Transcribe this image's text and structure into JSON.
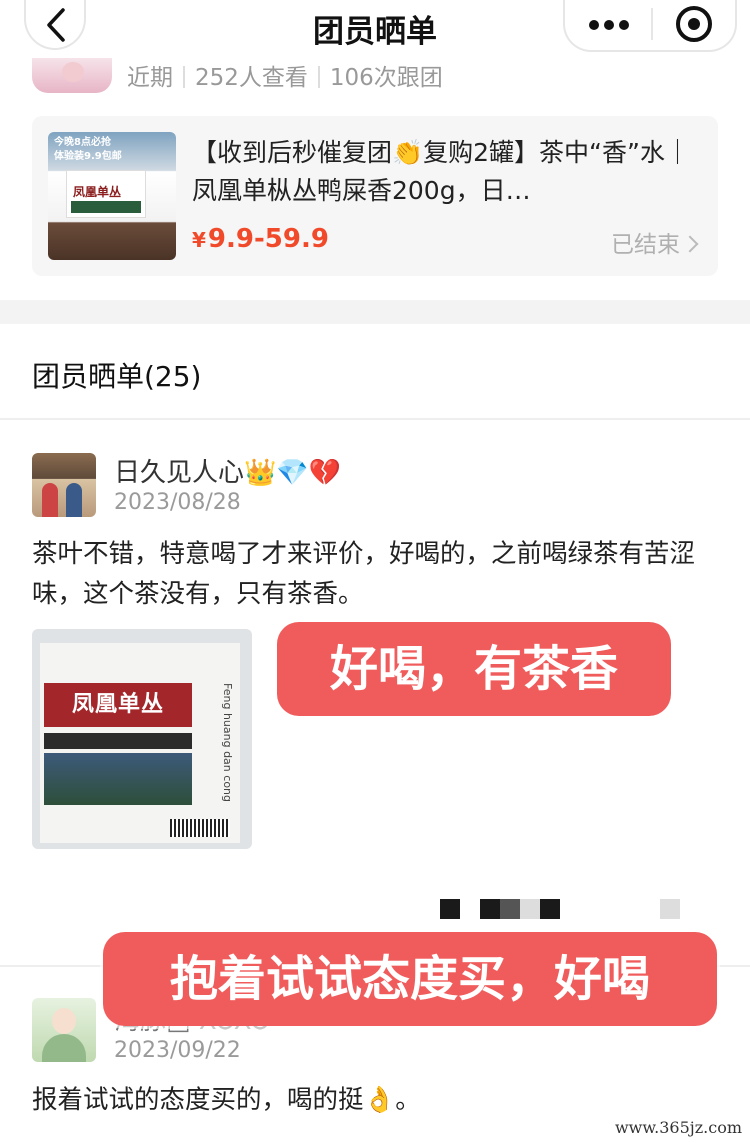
{
  "header": {
    "title": "团员晒单",
    "back_icon": "chevron-left-icon",
    "more_icon": "more-dots-icon",
    "close_icon": "target-icon"
  },
  "stats": {
    "recent": "近期",
    "viewers": "252人查看",
    "joins": "106次跟团"
  },
  "product": {
    "image_promo_line1": "今晚8点必抢",
    "image_promo_line2": "体验装9.9包邮",
    "image_pkg_name": "凤凰单丛",
    "title": "【收到后秒催复团👏复购2罐】茶中“香”水｜凤凰单枞丛鸭屎香200g，日…",
    "price_symbol": "¥",
    "price": "9.9-59.9",
    "status": "已结束"
  },
  "section": {
    "title": "团员晒单(25)"
  },
  "reviews": [
    {
      "name": "日久见人心👑💎💔",
      "date": "2023/08/28",
      "text": "茶叶不错，特意喝了才来评价，好喝的，之前喝绿茶有苦涩味，这个茶没有，只有茶香。",
      "photo_label": "凤凰单丛",
      "photo_vertical_text": "Feng huang dan cong"
    },
    {
      "name": "海豚□ XOXO",
      "date": "2023/09/22",
      "text": "报着试试的态度买的，喝的挺👌。"
    }
  ],
  "overlay_labels": {
    "label_1": "好喝，有茶香",
    "label_2": "抱着试试态度买，好喝"
  },
  "watermark": "www.365jz.com",
  "colors": {
    "accent_price": "#f04a2a",
    "overlay_red": "#f05c5c",
    "card_bg": "#f6f6f6"
  }
}
